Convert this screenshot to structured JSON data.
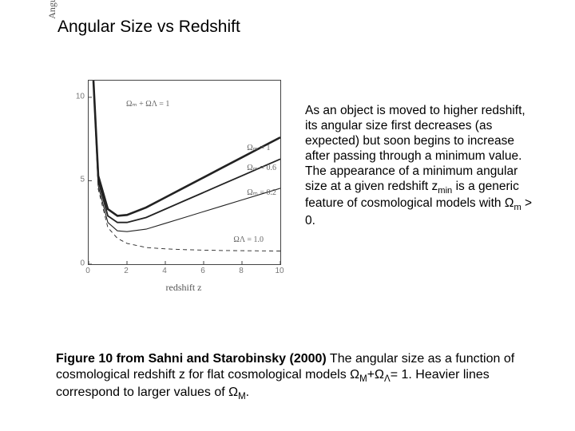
{
  "title": "Angular Size vs Redshift",
  "body": {
    "t0": "As an object is moved to higher redshift, its angular size first decreases (as expected) but soon begins to increase after passing through a minimum value. The appearance of a minimum angular size at a given redshift z",
    "sub0": "min",
    "t1": " is a generic feature of cosmological models with Ω",
    "sub1": "m",
    "t2": " > 0."
  },
  "caption": {
    "bold": "Figure 10 from Sahni and Starobinsky (2000)",
    "c0": "  The angular size as a function of cosmological redshift z for flat cosmological models Ω",
    "csub0": "M",
    "c1": "+Ω",
    "csub1": "Λ",
    "c2": "= 1. Heavier lines correspond to larger values of Ω",
    "csub2": "M",
    "c3": "."
  },
  "chart_data": {
    "type": "line",
    "title": "",
    "xlabel": "redshift z",
    "ylabel": "Angular size Δθ",
    "xlim": [
      0,
      10
    ],
    "ylim": [
      0,
      11
    ],
    "x_ticks": [
      0,
      2,
      4,
      6,
      8,
      10
    ],
    "y_ticks": [
      0,
      5,
      10
    ],
    "top_label": "Ωₘ + ΩΛ = 1",
    "x": [
      0.25,
      0.5,
      1,
      1.5,
      2,
      3,
      4,
      5,
      6,
      7,
      8,
      9,
      10
    ],
    "series": [
      {
        "name": "Ωₘ = 1",
        "values": [
          11.0,
          5.3,
          3.3,
          2.9,
          2.95,
          3.4,
          4.0,
          4.6,
          5.2,
          5.8,
          6.4,
          7.0,
          7.6
        ],
        "weight": 2.6,
        "style": "solid"
      },
      {
        "name": "Ωₘ = 0.6",
        "values": [
          11.0,
          5.0,
          2.9,
          2.5,
          2.5,
          2.8,
          3.3,
          3.8,
          4.3,
          4.8,
          5.3,
          5.8,
          6.3
        ],
        "weight": 1.8,
        "style": "solid"
      },
      {
        "name": "Ωₘ = 0.2",
        "values": [
          11.0,
          4.7,
          2.5,
          2.0,
          1.95,
          2.1,
          2.45,
          2.8,
          3.15,
          3.5,
          3.85,
          4.2,
          4.55
        ],
        "weight": 1.1,
        "style": "solid"
      },
      {
        "name": "ΩΛ = 1.0",
        "values": [
          11.0,
          4.5,
          2.2,
          1.55,
          1.25,
          1.0,
          0.92,
          0.87,
          0.84,
          0.82,
          0.81,
          0.8,
          0.79
        ],
        "weight": 0.9,
        "style": "dashed"
      }
    ],
    "label_positions": [
      {
        "text": "Ωₘ = 1",
        "x": 8.3,
        "y": 6.9
      },
      {
        "text": "Ωₘ = 0.6",
        "x": 8.3,
        "y": 5.7
      },
      {
        "text": "Ωₘ = 0.2",
        "x": 8.3,
        "y": 4.2
      },
      {
        "text": "ΩΛ = 1.0",
        "x": 7.6,
        "y": 1.4
      }
    ],
    "top_label_pos": {
      "x": 2.0,
      "y": 9.8
    }
  }
}
